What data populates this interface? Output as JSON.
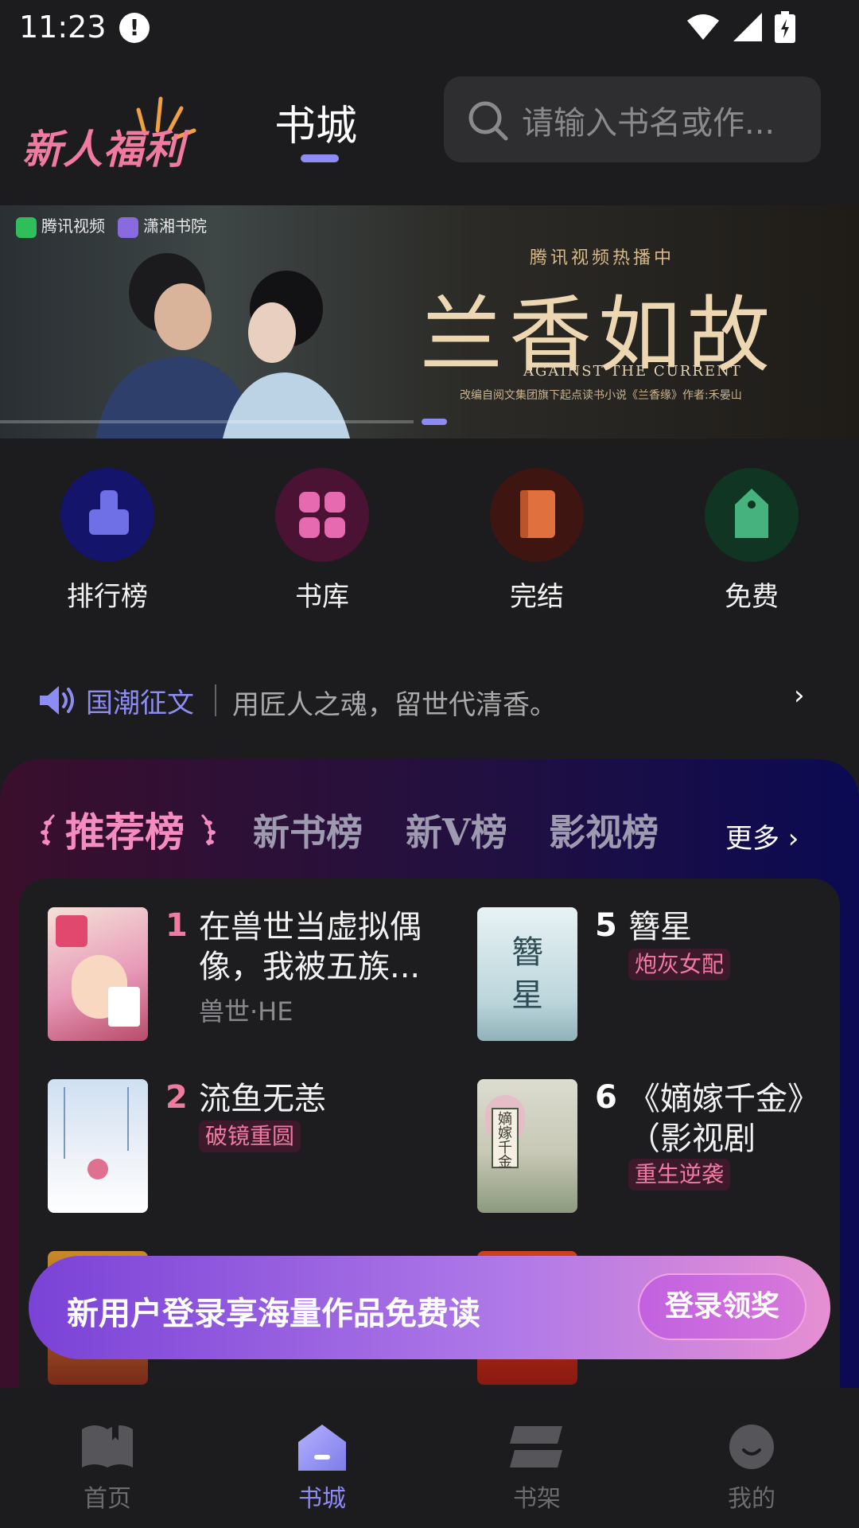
{
  "status_bar": {
    "time": "11:23",
    "alert": "!"
  },
  "header": {
    "promo_text": "新人福利",
    "tab_label": "书城",
    "search_placeholder": "请输入书名或作..."
  },
  "banner": {
    "logo1": "腾讯视频",
    "logo2": "潇湘书院",
    "subtitle": "腾讯视频热播中",
    "title": "兰香如故",
    "english": "AGAINST THE CURRENT",
    "note": "改编自阅文集团旗下起点读书小说《兰香缘》作者:禾晏山"
  },
  "quick_entries": [
    {
      "label": "排行榜",
      "icon": "ranking-icon",
      "color": "#6f6fe6"
    },
    {
      "label": "书库",
      "icon": "library-icon",
      "color": "#e66ab0"
    },
    {
      "label": "完结",
      "icon": "completed-book-icon",
      "color": "#e0703d"
    },
    {
      "label": "免费",
      "icon": "free-tag-icon",
      "color": "#46b27e"
    }
  ],
  "notice": {
    "tag": "国潮征文",
    "text": "用匠人之魂，留世代清香。",
    "arrow": "›"
  },
  "rank": {
    "tabs": [
      "推荐榜",
      "新书榜",
      "新V榜",
      "影视榜"
    ],
    "more": "更多 ›",
    "books": [
      {
        "rank": "1",
        "title": "在兽世当虚拟偶像，我被五族...",
        "sub": "兽世·HE",
        "tag": ""
      },
      {
        "rank": "5",
        "title": "簪星",
        "sub": "",
        "tag": "炮灰女配"
      },
      {
        "rank": "2",
        "title": "流鱼无恙",
        "sub": "",
        "tag": "破镜重圆"
      },
      {
        "rank": "6",
        "title": "《嫡嫁千金》（影视剧《墨",
        "sub": "",
        "tag": "重生逆袭"
      }
    ]
  },
  "login_banner": {
    "text": "新用户登录享海量作品免费读",
    "button": "登录领奖"
  },
  "bottom_nav": [
    {
      "label": "首页",
      "icon": "home-book-icon"
    },
    {
      "label": "书城",
      "icon": "bookstore-icon"
    },
    {
      "label": "书架",
      "icon": "bookshelf-icon"
    },
    {
      "label": "我的",
      "icon": "profile-icon"
    }
  ]
}
